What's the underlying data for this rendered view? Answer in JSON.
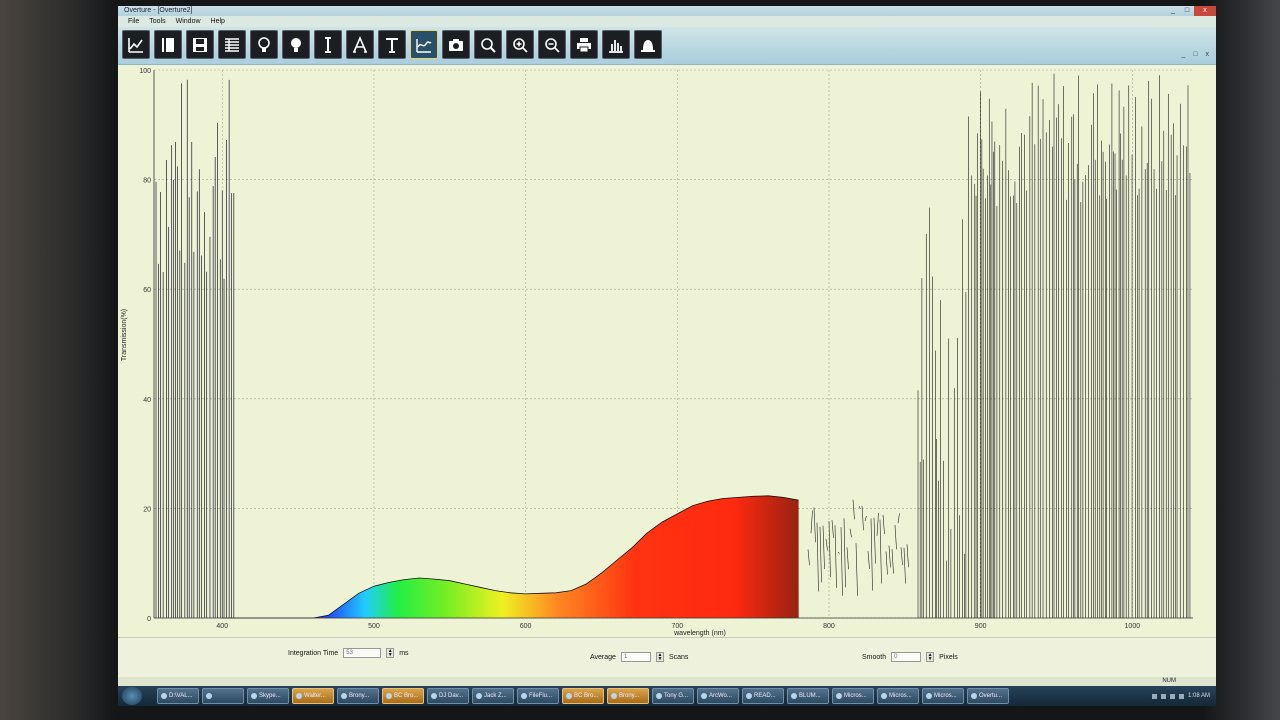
{
  "window": {
    "title": "Overture - [Overture2]",
    "controls": [
      "_",
      "□",
      "x"
    ]
  },
  "menu": [
    "File",
    "Tools",
    "Window",
    "Help"
  ],
  "toolbar": {
    "icons": [
      "graph-icon",
      "book-icon",
      "save-icon",
      "table-icon",
      "bulb-outline-icon",
      "bulb-filled-icon",
      "text-cursor-icon",
      "serif-a-icon",
      "text-t-icon",
      "spectrum-icon",
      "camera-icon",
      "zoom-fit-icon",
      "zoom-in-icon",
      "zoom-out-icon",
      "print-icon",
      "bars-icon",
      "bell-icon"
    ],
    "active_index": 9
  },
  "chart_data": {
    "type": "line",
    "title": "",
    "xlabel": "wavelength (nm)",
    "ylabel": "Transmission(%)",
    "xlim": [
      355,
      1040
    ],
    "ylim": [
      0,
      100
    ],
    "xticks": [
      400,
      500,
      600,
      700,
      800,
      900,
      1000
    ],
    "yticks": [
      0,
      20,
      40,
      60,
      80,
      100
    ],
    "grid": true,
    "series": [
      {
        "x": [
          400,
          460,
          470,
          480,
          490,
          500,
          510,
          520,
          530,
          540,
          550,
          560,
          570,
          580,
          590,
          600,
          610,
          620,
          630,
          640,
          650,
          660,
          670,
          680,
          690,
          700,
          710,
          720,
          730,
          740,
          750,
          760,
          770,
          780
        ],
        "y": [
          0,
          0,
          0.5,
          2.5,
          4.5,
          5.8,
          6.5,
          7,
          7.3,
          7.1,
          6.8,
          6.2,
          5.6,
          5,
          4.6,
          4.4,
          4.5,
          4.6,
          5,
          6.2,
          8.2,
          10.5,
          12.8,
          15.5,
          17.5,
          19,
          20.5,
          21.3,
          21.8,
          22,
          22.2,
          22.3,
          22,
          21.5
        ]
      }
    ]
  },
  "controls": {
    "integration_label": "Integration Time",
    "integration_value": "53",
    "integration_unit": "ms",
    "average_label": "Average",
    "average_value": "1",
    "average_unit": "Scans",
    "smooth_label": "Smooth",
    "smooth_value": "0",
    "smooth_unit": "Pixels"
  },
  "status": {
    "num": "NUM"
  },
  "taskbar": {
    "items": [
      {
        "label": "D:\\VAL..."
      },
      {
        "label": ""
      },
      {
        "label": "Skype..."
      },
      {
        "label": "Walter...",
        "hl": true
      },
      {
        "label": "Brony..."
      },
      {
        "label": "BC Bro...",
        "hl": true
      },
      {
        "label": "DJ Dav..."
      },
      {
        "label": "Jack Z..."
      },
      {
        "label": "FileFlu..."
      },
      {
        "label": "BC Bro...",
        "hl": true
      },
      {
        "label": "Brony...",
        "hl": true
      },
      {
        "label": "Tony G..."
      },
      {
        "label": "ArcWo..."
      },
      {
        "label": "READ..."
      },
      {
        "label": "BLUM..."
      },
      {
        "label": "Micros..."
      },
      {
        "label": "Micros..."
      },
      {
        "label": "Micros..."
      },
      {
        "label": "Overtu..."
      }
    ],
    "clock": "1:08 AM"
  }
}
